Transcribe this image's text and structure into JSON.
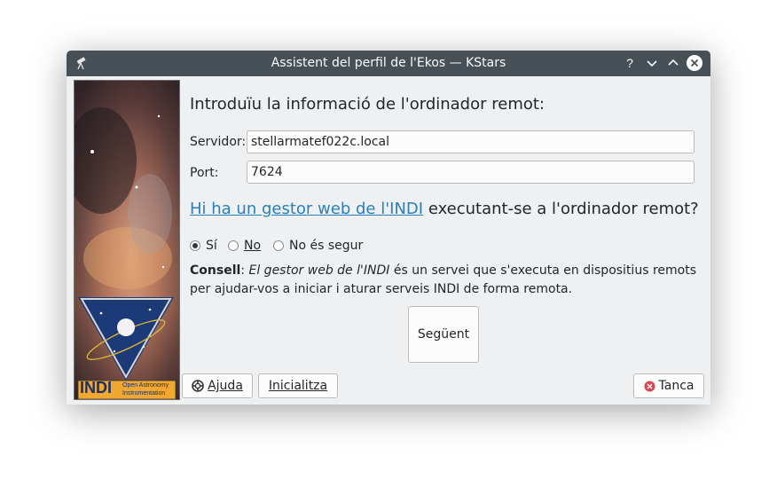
{
  "window": {
    "title": "Assistent del perfil de l'Ekos — KStars",
    "buttons": {
      "help": "?",
      "minimize": "⌄",
      "maximize": "⌃",
      "close": "×"
    }
  },
  "side_image": {
    "logo_text": "INDI",
    "logo_subtext_1": "Open Astronomy",
    "logo_subtext_2": "Instrumentation"
  },
  "form": {
    "heading": "Introduïu la informació de l'ordinador remot:",
    "server_label": "Servidor:",
    "server_value": "stellarmatef022c.local",
    "port_label": "Port:",
    "port_value": "7624"
  },
  "question": {
    "link_text": "Hi ha un gestor web de l'INDI",
    "rest_text": " executant-se a l'ordinador remot?"
  },
  "radios": [
    {
      "label": "Sí",
      "checked": true
    },
    {
      "label": "No",
      "checked": false
    },
    {
      "label": "No és segur",
      "checked": false
    }
  ],
  "tip": {
    "bold": "Consell",
    "sep": ": ",
    "italic": "El gestor web de l'INDI",
    "rest": " és un servei que s'executa en dispositius remots per ajudar-vos a iniciar i aturar serveis INDI de forma remota."
  },
  "buttons": {
    "next": "Següent",
    "help": "Ajuda",
    "reset": "Inicialitza",
    "close": "Tanca"
  },
  "colors": {
    "titlebar": "#475057",
    "link": "#2980b9",
    "close_icon": "#da4453",
    "window_bg": "#eff0f1"
  }
}
